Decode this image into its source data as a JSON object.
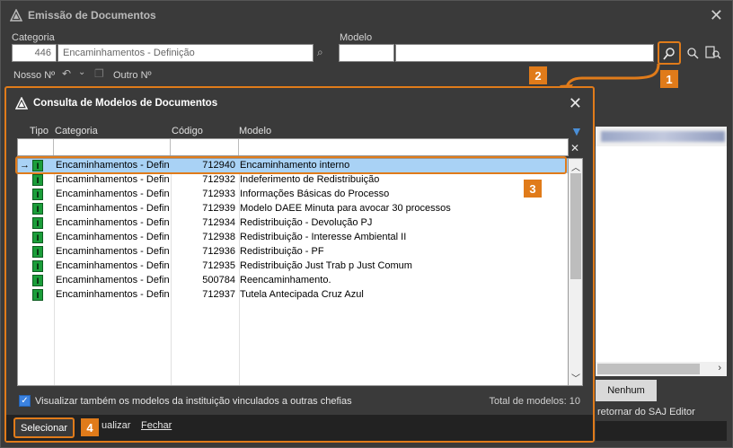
{
  "outer": {
    "title": "Emissão de Documentos",
    "categoria_label": "Categoria",
    "categoria_code": "446",
    "categoria_value": "Encaminhamentos - Definição",
    "modelo_label": "Modelo",
    "nosso_label": "Nosso Nº",
    "outro_label": "Outro Nº",
    "nenhum_button": "Nenhum",
    "saj_text": "retornar do SAJ Editor"
  },
  "badges": {
    "b1": "1",
    "b2": "2",
    "b3": "3",
    "b4": "4"
  },
  "dialog": {
    "title": "Consulta de Modelos de Documentos",
    "columns": {
      "tipo": "Tipo",
      "categoria": "Categoria",
      "codigo": "Código",
      "modelo": "Modelo"
    },
    "rows": [
      {
        "categoria": "Encaminhamentos - Defin",
        "codigo": "712940",
        "modelo": "Encaminhamento interno",
        "selected": true
      },
      {
        "categoria": "Encaminhamentos - Defin",
        "codigo": "712932",
        "modelo": "Indeferimento de Redistribuição"
      },
      {
        "categoria": "Encaminhamentos - Defin",
        "codigo": "712933",
        "modelo": "Informações Básicas do Processo"
      },
      {
        "categoria": "Encaminhamentos - Defin",
        "codigo": "712939",
        "modelo": "Modelo DAEE Minuta para avocar 30 processos"
      },
      {
        "categoria": "Encaminhamentos - Defin",
        "codigo": "712934",
        "modelo": "Redistribuição - Devolução PJ"
      },
      {
        "categoria": "Encaminhamentos - Defin",
        "codigo": "712938",
        "modelo": "Redistribuição - Interesse Ambiental II"
      },
      {
        "categoria": "Encaminhamentos - Defin",
        "codigo": "712936",
        "modelo": "Redistribuição - PF"
      },
      {
        "categoria": "Encaminhamentos - Defin",
        "codigo": "712935",
        "modelo": "Redistribuição Just Trab p Just Comum"
      },
      {
        "categoria": "Encaminhamentos - Defin",
        "codigo": "500784",
        "modelo": "Reencaminhamento."
      },
      {
        "categoria": "Encaminhamentos - Defin",
        "codigo": "712937",
        "modelo": "Tutela Antecipada Cruz Azul"
      }
    ],
    "tipo_glyph": "I",
    "checkbox_label": "Visualizar também os modelos da instituição vinculados a outras chefias",
    "total_label": "Total de modelos: 10",
    "buttons": {
      "selecionar": "Selecionar",
      "visualizar": "ualizar",
      "fechar": "Fechar"
    }
  }
}
